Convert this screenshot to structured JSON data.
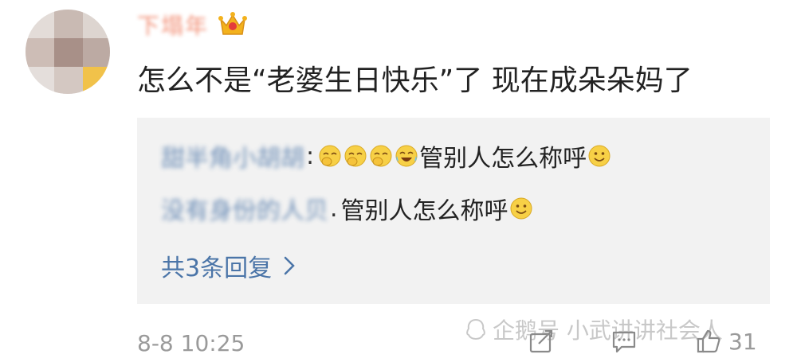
{
  "comment": {
    "username": "下塌年",
    "text": "怎么不是“老婆生日快乐”了 现在成朵朵妈了",
    "timestamp": "8-8 10:25"
  },
  "replies": [
    {
      "name": "甜半角小胡胡",
      "separator": ":",
      "text": "管别人怎么称呼",
      "emojis": [
        "facepalm-emoji",
        "facepalm-emoji",
        "facepalm-emoji",
        "laugh-cry-emoji"
      ],
      "trailing_emoji": "smile-emoji"
    },
    {
      "name": "没有身份的人贝",
      "separator": ".",
      "text": "管别人怎么称呼",
      "emojis": [],
      "trailing_emoji": "smile-emoji"
    }
  ],
  "more_replies_label": "共3条回复",
  "watermark": "企鹅号 小武讲讲社会人",
  "actions": {
    "like_count": "31"
  },
  "icons": [
    "crown-icon",
    "chevron-right-icon",
    "share-icon",
    "comment-icon",
    "like-icon",
    "watermark-logo-icon"
  ],
  "colors": {
    "link": "#4b75a8",
    "username": "#f07f62",
    "reply_bg": "#f2f2f2",
    "meta": "#9a9a9a"
  }
}
